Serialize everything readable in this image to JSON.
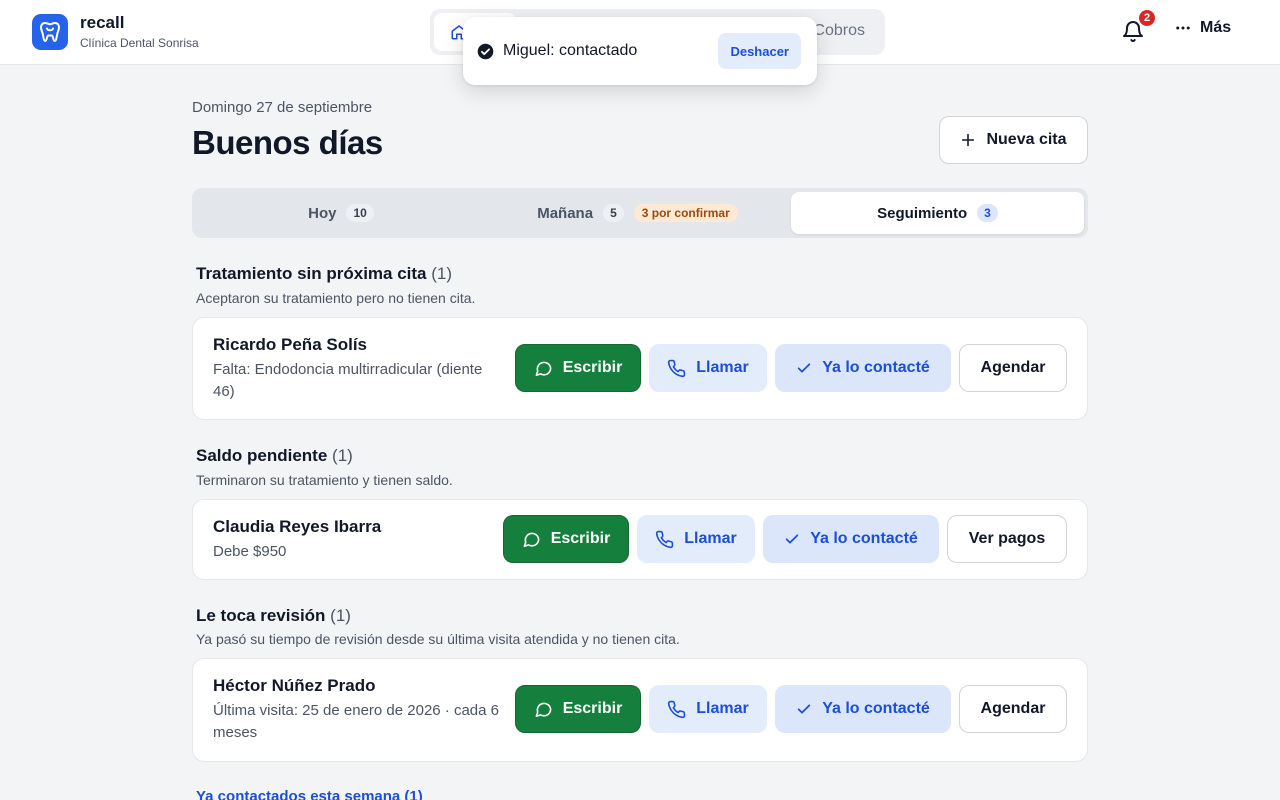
{
  "app": {
    "name": "recall",
    "clinic": "Clínica Dental Sonrisa"
  },
  "nav": {
    "cobros_label": "Cobros"
  },
  "header": {
    "notifications_count": "2",
    "more_label": "Más"
  },
  "toast": {
    "message": "Miguel: contactado",
    "undo_label": "Deshacer"
  },
  "page": {
    "date": "Domingo 27 de septiembre",
    "greeting": "Buenos días",
    "new_appointment_label": "Nueva cita"
  },
  "tabs": [
    {
      "label": "Hoy",
      "count": "10"
    },
    {
      "label": "Mañana",
      "count": "5",
      "badge": "3 por confirmar"
    },
    {
      "label": "Seguimiento",
      "count": "3",
      "active": true
    }
  ],
  "sections": [
    {
      "title": "Tratamiento sin próxima cita",
      "count": "(1)",
      "description": "Aceptaron su tratamiento pero no tienen cita.",
      "patient": {
        "name": "Ricardo Peña Solís",
        "detail": "Falta: Endodoncia multirradicular (diente 46)"
      },
      "actions": {
        "write": "Escribir",
        "call": "Llamar",
        "done": "Ya lo contacté",
        "secondary": "Agendar"
      }
    },
    {
      "title": "Saldo pendiente",
      "count": "(1)",
      "description": "Terminaron su tratamiento y tienen saldo.",
      "patient": {
        "name": "Claudia Reyes Ibarra",
        "detail": "Debe $950"
      },
      "actions": {
        "write": "Escribir",
        "call": "Llamar",
        "done": "Ya lo contacté",
        "secondary": "Ver pagos"
      }
    },
    {
      "title": "Le toca revisión",
      "count": "(1)",
      "description": "Ya pasó su tiempo de revisión desde su última visita atendida y no tienen cita.",
      "patient": {
        "name": "Héctor Núñez Prado",
        "detail": "Última visita: 25 de enero de 2026 · cada 6 meses"
      },
      "actions": {
        "write": "Escribir",
        "call": "Llamar",
        "done": "Ya lo contacté",
        "secondary": "Agendar"
      }
    }
  ],
  "footer": {
    "contacted_link": "Ya contactados esta semana (1)"
  },
  "colors": {
    "primary": "#2563eb",
    "whatsapp_green": "#15803d",
    "background": "#f3f4f6",
    "badge_red": "#dc2626"
  },
  "icons": [
    "tooth-icon",
    "home-icon",
    "bell-icon",
    "more-dots-icon",
    "check-circle-icon",
    "plus-icon",
    "chat-bubble-icon",
    "phone-icon",
    "check-icon"
  ]
}
